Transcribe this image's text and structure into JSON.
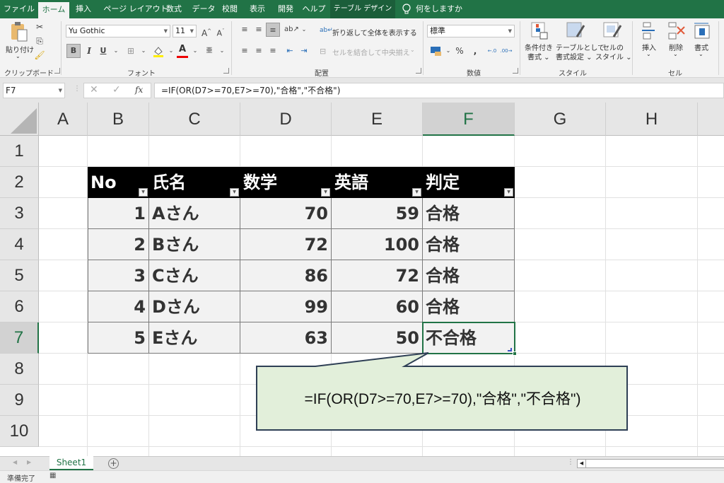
{
  "menu": {
    "tabs": [
      {
        "label": "ファイル",
        "state": "normal"
      },
      {
        "label": "ホーム",
        "state": "active"
      },
      {
        "label": "挿入",
        "state": "normal"
      },
      {
        "label": "ページ レイアウト",
        "state": "normal"
      },
      {
        "label": "数式",
        "state": "normal"
      },
      {
        "label": "データ",
        "state": "normal"
      },
      {
        "label": "校閲",
        "state": "normal"
      },
      {
        "label": "表示",
        "state": "normal"
      },
      {
        "label": "開発",
        "state": "normal"
      },
      {
        "label": "ヘルプ",
        "state": "normal"
      },
      {
        "label": "テーブル デザイン",
        "state": "contextual"
      }
    ],
    "tell_me": "何をしますか"
  },
  "ribbon": {
    "clipboard": {
      "paste": "貼り付け",
      "group": "クリップボード"
    },
    "font": {
      "name": "Yu Gothic",
      "size": "11",
      "group": "フォント",
      "bold": "B",
      "italic": "I",
      "underline": "U"
    },
    "alignment": {
      "wrap": "折り返して全体を表示する",
      "merge": "セルを結合して中央揃え",
      "group": "配置"
    },
    "number": {
      "format": "標準",
      "percent": "%",
      "comma": ",",
      "group": "数値"
    },
    "styles": {
      "conditional_1": "条件付き",
      "conditional_2": "書式",
      "table_1": "テーブルとして",
      "table_2": "書式設定",
      "cell_1": "セルの",
      "cell_2": "スタイル",
      "group": "スタイル"
    },
    "cells": {
      "insert": "挿入",
      "delete": "削除",
      "format": "書式",
      "group": "セル"
    }
  },
  "formula_bar": {
    "name_box": "F7",
    "fx": "fx",
    "formula": "=IF(OR(D7>=70,E7>=70),\"合格\",\"不合格\")"
  },
  "sheet": {
    "columns": [
      "A",
      "B",
      "C",
      "D",
      "E",
      "F",
      "G",
      "H"
    ],
    "selected_column": "F",
    "rows": [
      "1",
      "2",
      "3",
      "4",
      "5",
      "6",
      "7",
      "8",
      "9",
      "10"
    ],
    "selected_row": "7",
    "active_cell": "F7",
    "table": {
      "headers": [
        "No",
        "氏名",
        "数学",
        "英語",
        "判定"
      ],
      "rows": [
        [
          "1",
          "Aさん",
          "70",
          "59",
          "合格"
        ],
        [
          "2",
          "Bさん",
          "72",
          "100",
          "合格"
        ],
        [
          "3",
          "Cさん",
          "86",
          "72",
          "合格"
        ],
        [
          "4",
          "Dさん",
          "99",
          "60",
          "合格"
        ],
        [
          "5",
          "Eさん",
          "63",
          "50",
          "不合格"
        ]
      ]
    }
  },
  "callout": {
    "text": "=IF(OR(D7>=70,E7>=70),\"合格\",\"不合格\")",
    "fill": "#e2efda",
    "border": "#2e3f55"
  },
  "sheet_tabs": {
    "tabs": [
      "Sheet1"
    ],
    "active": "Sheet1"
  },
  "status": {
    "text": "準備完了"
  },
  "colors": {
    "brand": "#217346",
    "header_fill": "#000000",
    "body_fill": "#f2f2f2"
  }
}
